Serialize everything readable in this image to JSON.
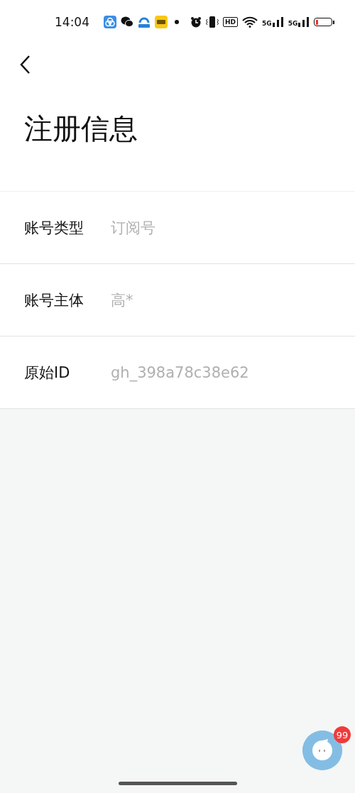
{
  "status_bar": {
    "time": "14:04",
    "hd_label": "HD",
    "network_labels": [
      "5G",
      "5G"
    ]
  },
  "title": "注册信息",
  "rows": [
    {
      "label": "账号类型",
      "value": "订阅号"
    },
    {
      "label": "账号主体",
      "value": "高*"
    },
    {
      "label": "原始ID",
      "value": "gh_398a78c38e62"
    }
  ],
  "floating_badge": "99"
}
